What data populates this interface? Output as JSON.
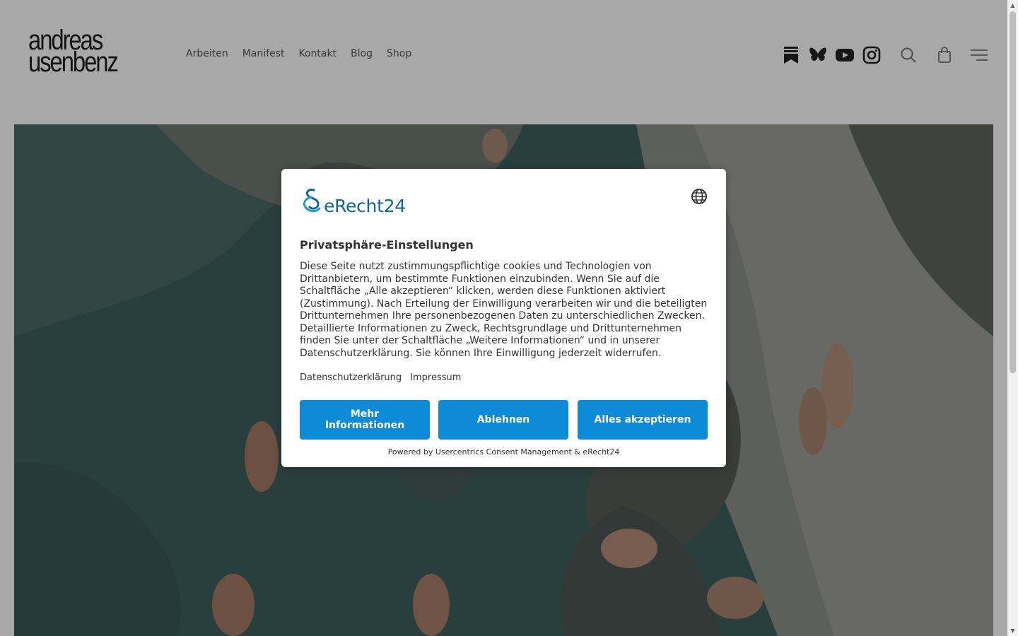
{
  "header": {
    "logo": {
      "line1": "andreas",
      "line2": "usenbenz"
    },
    "nav": [
      {
        "label": "Arbeiten"
      },
      {
        "label": "Manifest"
      },
      {
        "label": "Kontakt"
      },
      {
        "label": "Blog"
      },
      {
        "label": "Shop"
      }
    ],
    "icons": [
      "substack-icon",
      "butterfly-icon",
      "youtube-icon",
      "instagram-icon",
      "search-icon",
      "shopping-bag-icon",
      "menu-icon"
    ]
  },
  "consent": {
    "brand": "eRecht24",
    "title": "Privatsphäre-Einstellungen",
    "body": "Diese Seite nutzt zustimmungspflichtige cookies und Technologien von Drittanbietern, um bestimmte Funktionen einzubinden. Wenn Sie auf die Schaltfläche „Alle akzeptieren“ klicken, werden diese Funktionen aktiviert (Zustimmung). Nach Erteilung der Einwilligung verarbeiten wir und die beteiligten Drittunternehmen Ihre personenbezogenen Daten zu unterschiedlichen Zwecken. Detaillierte Informationen zu Zweck, Rechtsgrundlage und Drittunternehmen finden Sie unter der Schaltfläche „Weitere Informationen“ und in unserer Datenschutzerklärung. Sie können Ihre Einwilligung jederzeit widerrufen.",
    "links": {
      "privacy": "Datenschutzerklärung",
      "imprint": "Impressum"
    },
    "buttons": {
      "more": "Mehr Informationen",
      "deny": "Ablehnen",
      "accept": "Alles akzeptieren"
    },
    "powered_by": "Powered by Usercentrics Consent Management & eRecht24"
  },
  "colors": {
    "accent": "#0e8bd6",
    "brand": "#12649a",
    "text": "#333333",
    "overlay": "#000000"
  }
}
